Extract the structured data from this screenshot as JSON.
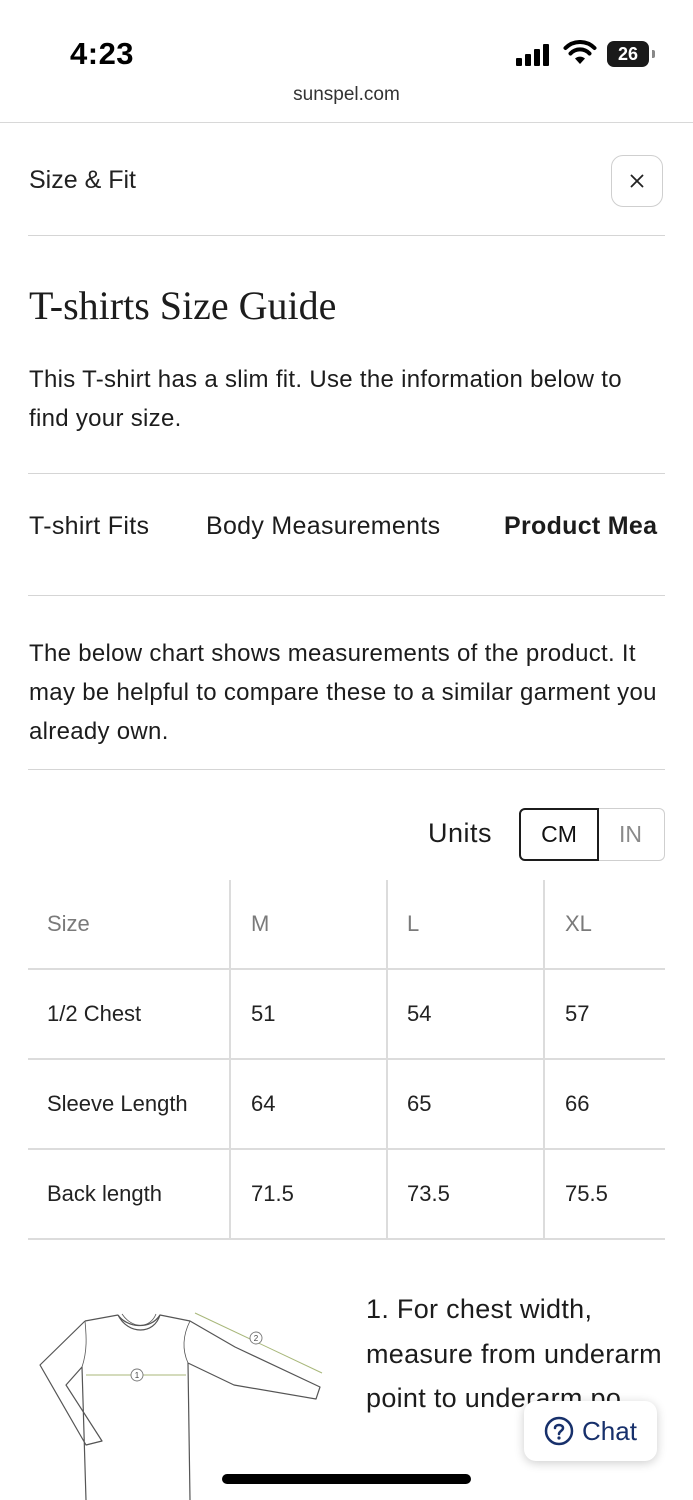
{
  "status_bar": {
    "time": "4:23",
    "battery": "26"
  },
  "browser": {
    "url": "sunspel.com"
  },
  "modal": {
    "title": "Size & Fit",
    "close_symbol": "×"
  },
  "guide": {
    "heading": "T-shirts Size Guide",
    "intro": "This T-shirt has a slim fit. Use the information below to find your size."
  },
  "tabs": [
    {
      "label": "T-shirt Fits",
      "active": false
    },
    {
      "label": "Body Measurements",
      "active": false
    },
    {
      "label": "Product Mea",
      "active": true
    }
  ],
  "description": "The below chart shows measurements of the product. It may be helpful to compare these to a similar garment you already own.",
  "units": {
    "label": "Units",
    "options": [
      "CM",
      "IN"
    ],
    "selected": "CM"
  },
  "size_table": {
    "headers": [
      "Size",
      "M",
      "L",
      "XL"
    ],
    "rows": [
      [
        "1/2 Chest",
        "51",
        "54",
        "57"
      ],
      [
        "Sleeve Length",
        "64",
        "65",
        "66"
      ],
      [
        "Back length",
        "71.5",
        "73.5",
        "75.5"
      ]
    ]
  },
  "illustration": {
    "marker_1": "1",
    "marker_2": "2"
  },
  "measure_note": "1. For chest width, measure from underarm point to underarm po",
  "chat": {
    "label": "Chat"
  },
  "colors": {
    "text": "#1c1c1c",
    "rule": "#d5d5d5",
    "chat_accent": "#17306b",
    "illustration_accent": "#a8b77a"
  }
}
